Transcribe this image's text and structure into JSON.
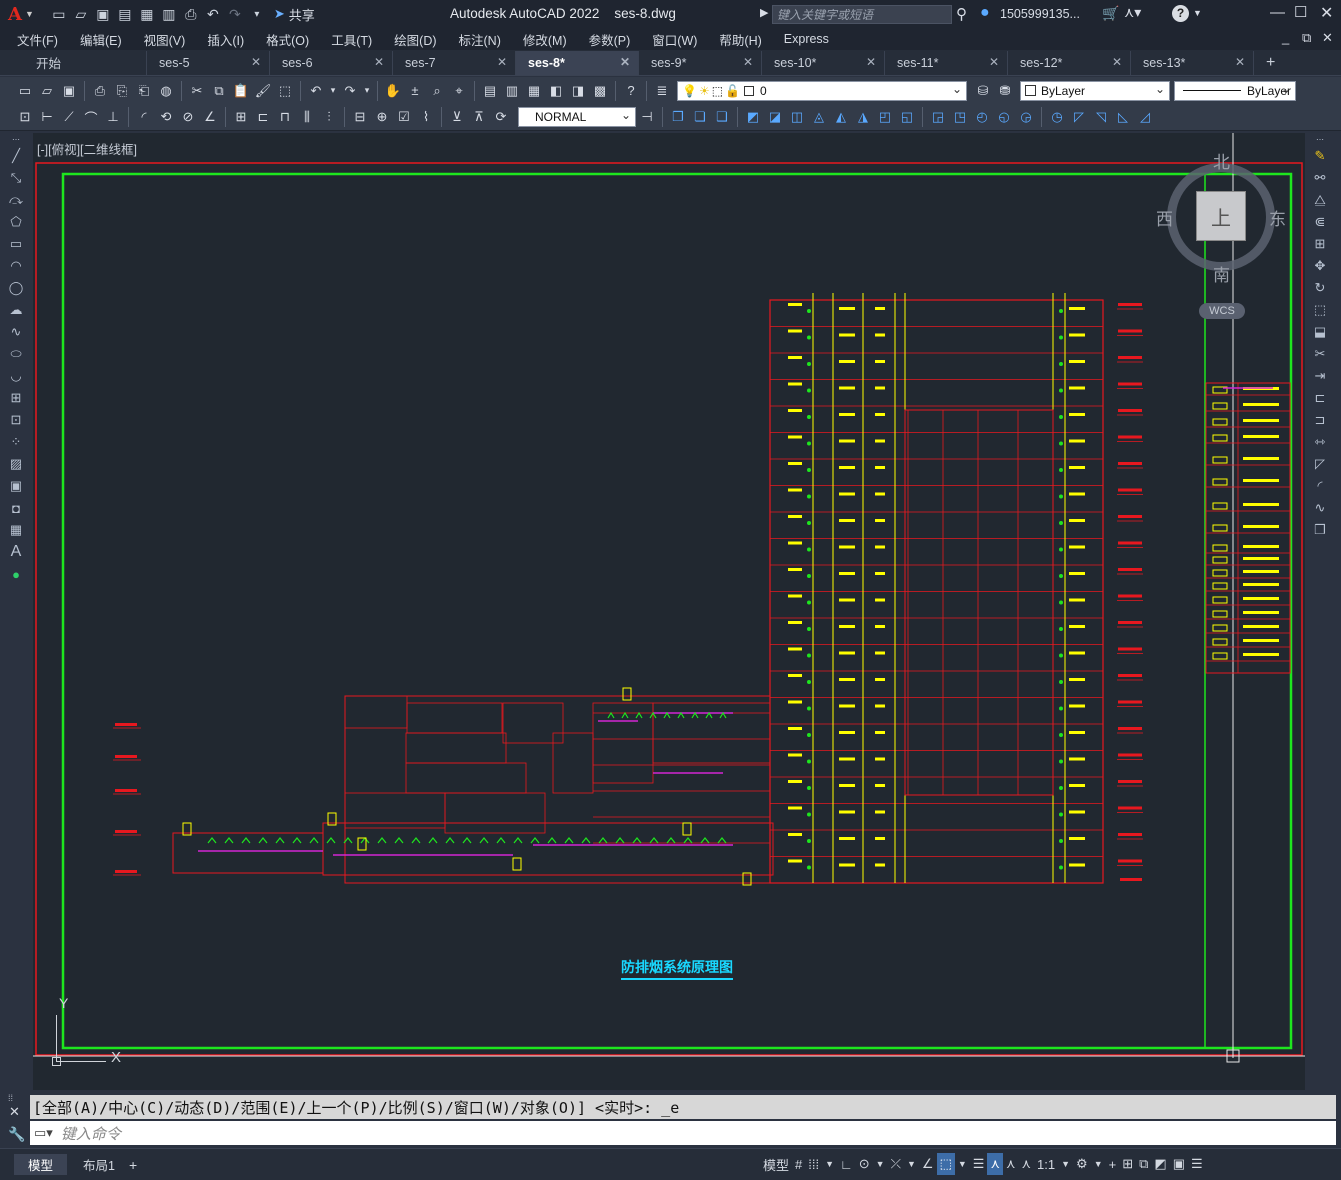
{
  "app": {
    "title": "Autodesk AutoCAD 2022",
    "file": "ses-8.dwg",
    "share": "共享",
    "search_placeholder": "键入关键字或短语",
    "user": "1505999135..."
  },
  "menu": [
    "文件(F)",
    "编辑(E)",
    "视图(V)",
    "插入(I)",
    "格式(O)",
    "工具(T)",
    "绘图(D)",
    "标注(N)",
    "修改(M)",
    "参数(P)",
    "窗口(W)",
    "帮助(H)",
    "Express"
  ],
  "tabs": [
    {
      "label": "开始",
      "active": false,
      "closable": false
    },
    {
      "label": "ses-5",
      "active": false,
      "closable": true
    },
    {
      "label": "ses-6",
      "active": false,
      "closable": true
    },
    {
      "label": "ses-7",
      "active": false,
      "closable": true
    },
    {
      "label": "ses-8*",
      "active": true,
      "closable": true
    },
    {
      "label": "ses-9*",
      "active": false,
      "closable": true
    },
    {
      "label": "ses-10*",
      "active": false,
      "closable": true
    },
    {
      "label": "ses-11*",
      "active": false,
      "closable": true
    },
    {
      "label": "ses-12*",
      "active": false,
      "closable": true
    },
    {
      "label": "ses-13*",
      "active": false,
      "closable": true
    }
  ],
  "toolbar": {
    "layer": "0",
    "color": "ByLayer",
    "linetype": "ByLayer",
    "textstyle": "NORMAL"
  },
  "viewport": {
    "label": "[-][俯视][二维线框]",
    "drawing_title": "防排烟系统原理图"
  },
  "viewcube": {
    "north": "北",
    "south": "南",
    "east": "东",
    "west": "西",
    "top": "上",
    "wcs": "WCS"
  },
  "ucs": {
    "y": "Y",
    "x": "X"
  },
  "command": {
    "history": "[全部(A)/中心(C)/动态(D)/范围(E)/上一个(P)/比例(S)/窗口(W)/对象(O)] <实时>: _e",
    "placeholder": "键入命令"
  },
  "status": {
    "model_tab": "模型",
    "layout_tab": "布局1",
    "model": "模型",
    "scale": "1:1"
  },
  "colors": {
    "red": "#e8181f",
    "green": "#1ee61e",
    "yellow": "#ffff00",
    "magenta": "#d326d3",
    "cyan": "#19d8ff",
    "bg": "#212830"
  }
}
